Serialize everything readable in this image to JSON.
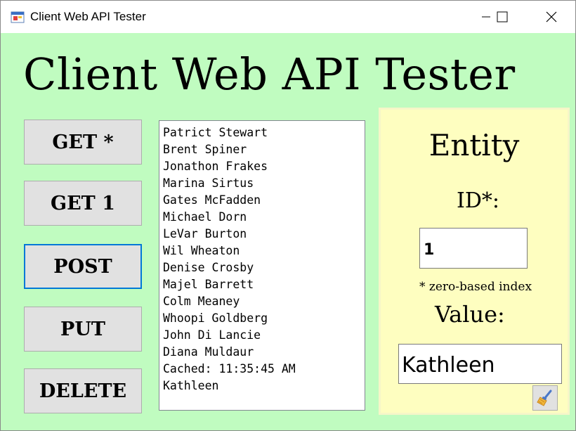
{
  "window": {
    "title": "Client Web API Tester"
  },
  "header": {
    "title": "Client Web API Tester"
  },
  "buttons": {
    "get_all": "GET *",
    "get_one": "GET 1",
    "post": "POST",
    "put": "PUT",
    "delete": "DELETE"
  },
  "list": {
    "items": [
      "Patrict Stewart",
      "Brent Spiner",
      "Jonathon Frakes",
      "Marina Sirtus",
      "Gates McFadden",
      "Michael Dorn",
      "LeVar Burton",
      "Wil Wheaton",
      "Denise Crosby",
      "Majel Barrett",
      "Colm Meaney",
      "Whoopi Goldberg",
      "John Di Lancie",
      "Diana Muldaur",
      "Cached: 11:35:45 AM",
      "Kathleen"
    ]
  },
  "entity": {
    "title": "Entity",
    "id_label": "ID*:",
    "id_value": "1",
    "hint": "* zero-based index",
    "value_label": "Value:",
    "value_value": "Kathleen"
  },
  "colors": {
    "form_background": "#c0fcc0",
    "panel_background": "#fefec0",
    "focus_border": "#0078d7"
  },
  "icons": {
    "app": "app-icon",
    "minimize": "minimize-icon",
    "maximize": "maximize-icon",
    "close": "close-icon",
    "clear": "broom-icon"
  }
}
